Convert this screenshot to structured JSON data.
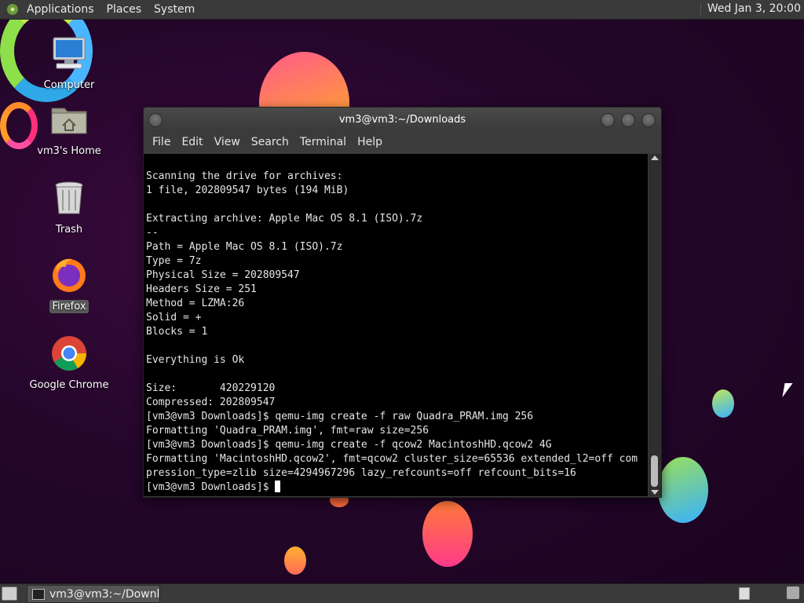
{
  "top_panel": {
    "menus": [
      "Applications",
      "Places",
      "System"
    ],
    "clock": "Wed Jan  3, 20:00"
  },
  "desktop_icons": {
    "computer": "Computer",
    "home": "vm3's Home",
    "trash": "Trash",
    "firefox": "Firefox",
    "chrome": "Google Chrome"
  },
  "terminal": {
    "title": "vm3@vm3:~/Downloads",
    "menus": [
      "File",
      "Edit",
      "View",
      "Search",
      "Terminal",
      "Help"
    ],
    "lines": [
      "Scanning the drive for archives:",
      "1 file, 202809547 bytes (194 MiB)",
      "",
      "Extracting archive: Apple Mac OS 8.1 (ISO).7z",
      "--",
      "Path = Apple Mac OS 8.1 (ISO).7z",
      "Type = 7z",
      "Physical Size = 202809547",
      "Headers Size = 251",
      "Method = LZMA:26",
      "Solid = +",
      "Blocks = 1",
      "",
      "Everything is Ok",
      "",
      "Size:       420229120",
      "Compressed: 202809547",
      "[vm3@vm3 Downloads]$ qemu-img create -f raw Quadra_PRAM.img 256",
      "Formatting 'Quadra_PRAM.img', fmt=raw size=256",
      "[vm3@vm3 Downloads]$ qemu-img create -f qcow2 MacintoshHD.qcow2 4G",
      "Formatting 'MacintoshHD.qcow2', fmt=qcow2 cluster_size=65536 extended_l2=off com",
      "pression_type=zlib size=4294967296 lazy_refcounts=off refcount_bits=16"
    ],
    "prompt": "[vm3@vm3 Downloads]$ "
  },
  "taskbar": {
    "task_label": "vm3@vm3:~/Downl..."
  }
}
